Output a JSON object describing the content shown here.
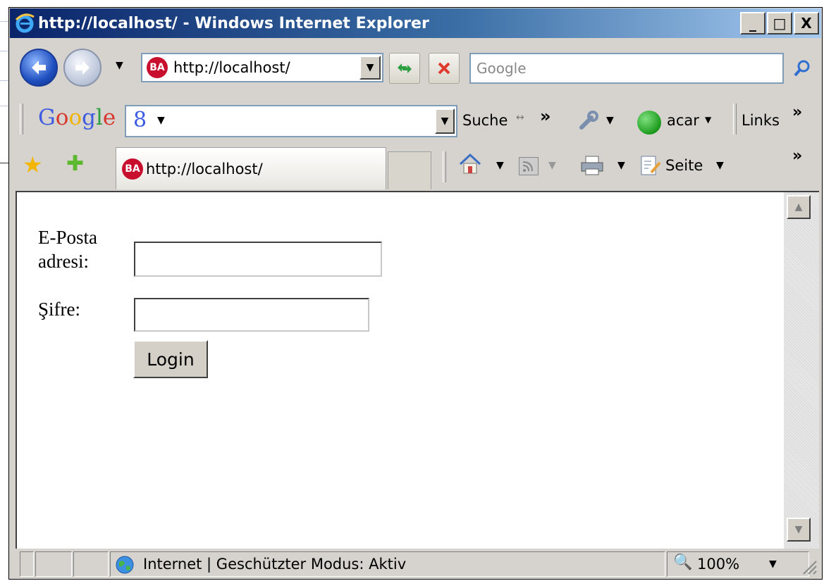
{
  "window": {
    "title": "http://localhost/ - Windows Internet Explorer",
    "minimize_label": "_",
    "maximize_label": "□",
    "close_label": "X"
  },
  "address_bar": {
    "url": "http://localhost/",
    "site_icon_text": "BA"
  },
  "search": {
    "placeholder": "Google"
  },
  "google_toolbar": {
    "logo": "Google",
    "search_label": "Suche",
    "more_label": "»",
    "account_label": "acar",
    "links_label": "Links"
  },
  "tabs": [
    {
      "title": "http://localhost/"
    }
  ],
  "command_bar": {
    "page_label": "Seite",
    "more_label": "»"
  },
  "form": {
    "email_label_line1": "E-Posta",
    "email_label_line2": "adresi:",
    "email_value": "",
    "password_label": "Şifre:",
    "password_value": "",
    "login_label": "Login"
  },
  "status_bar": {
    "zone_text": "Internet | Geschützter Modus: Aktiv",
    "zoom": "100%"
  },
  "colors": {
    "title_start": "#0a246a",
    "title_end": "#a6caf0",
    "chrome": "#d6d3ce"
  }
}
